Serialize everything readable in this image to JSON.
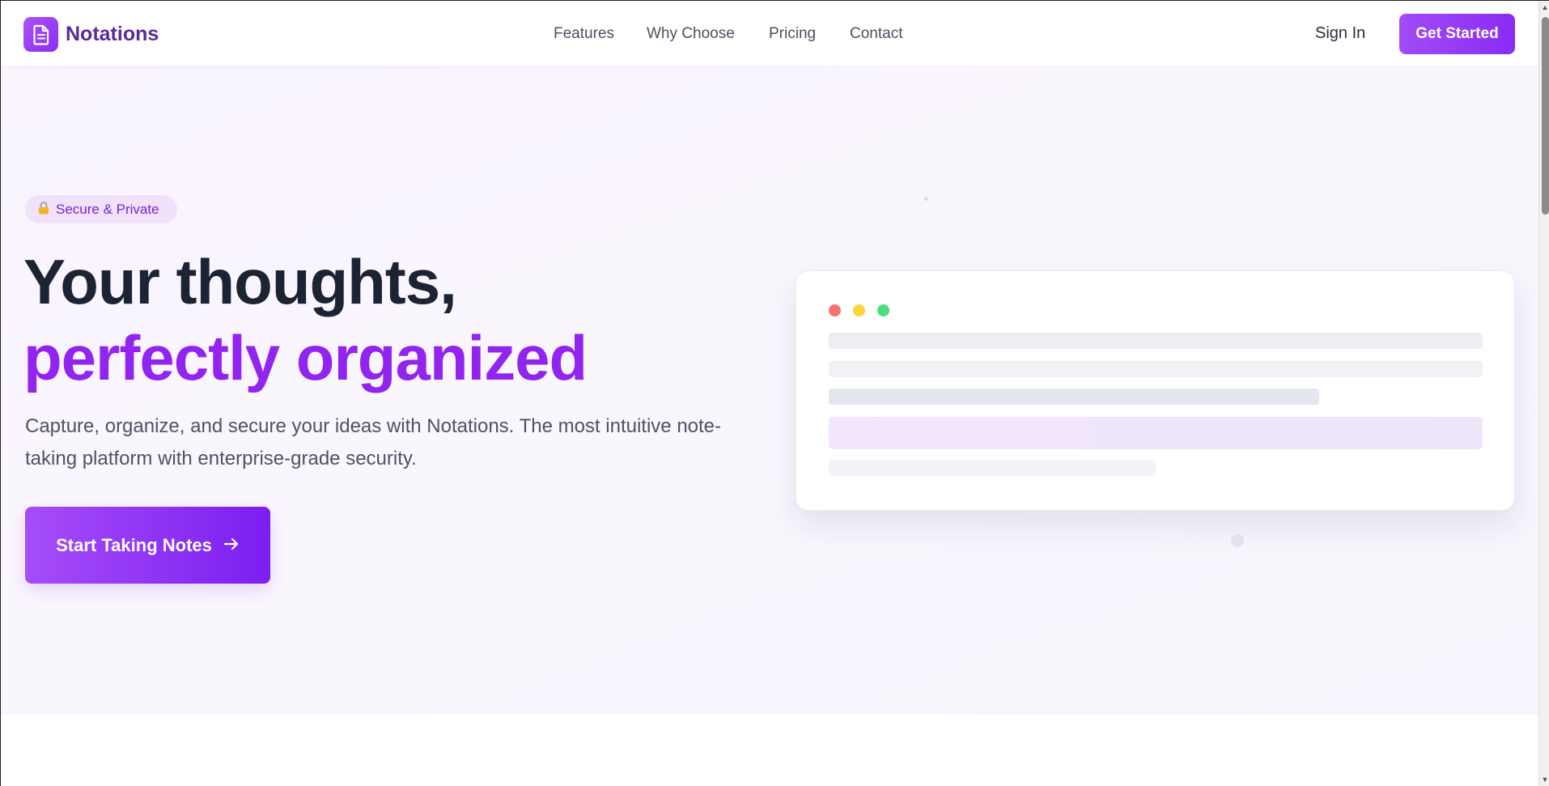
{
  "header": {
    "brand_name": "Notations",
    "brand_icon": "document-icon",
    "nav": [
      {
        "label": "Features"
      },
      {
        "label": "Why Choose"
      },
      {
        "label": "Pricing"
      },
      {
        "label": "Contact"
      }
    ],
    "sign_in_label": "Sign In",
    "get_started_label": "Get Started"
  },
  "hero": {
    "badge": {
      "icon": "lock-icon",
      "label": "Secure & Private"
    },
    "title_line_1": "Your thoughts,",
    "title_line_2": "perfectly organized",
    "subtitle": "Capture, organize, and secure your ideas with Notations. The most intuitive note-taking platform with enterprise-grade security.",
    "cta_label": "Start Taking Notes",
    "cta_icon": "arrow-right-icon"
  },
  "colors": {
    "accent": "#9124ee",
    "brand_text": "#5b2a9a",
    "heading": "#1c2333",
    "body_text": "#4c5363",
    "badge_bg": "#f1e2fc"
  }
}
